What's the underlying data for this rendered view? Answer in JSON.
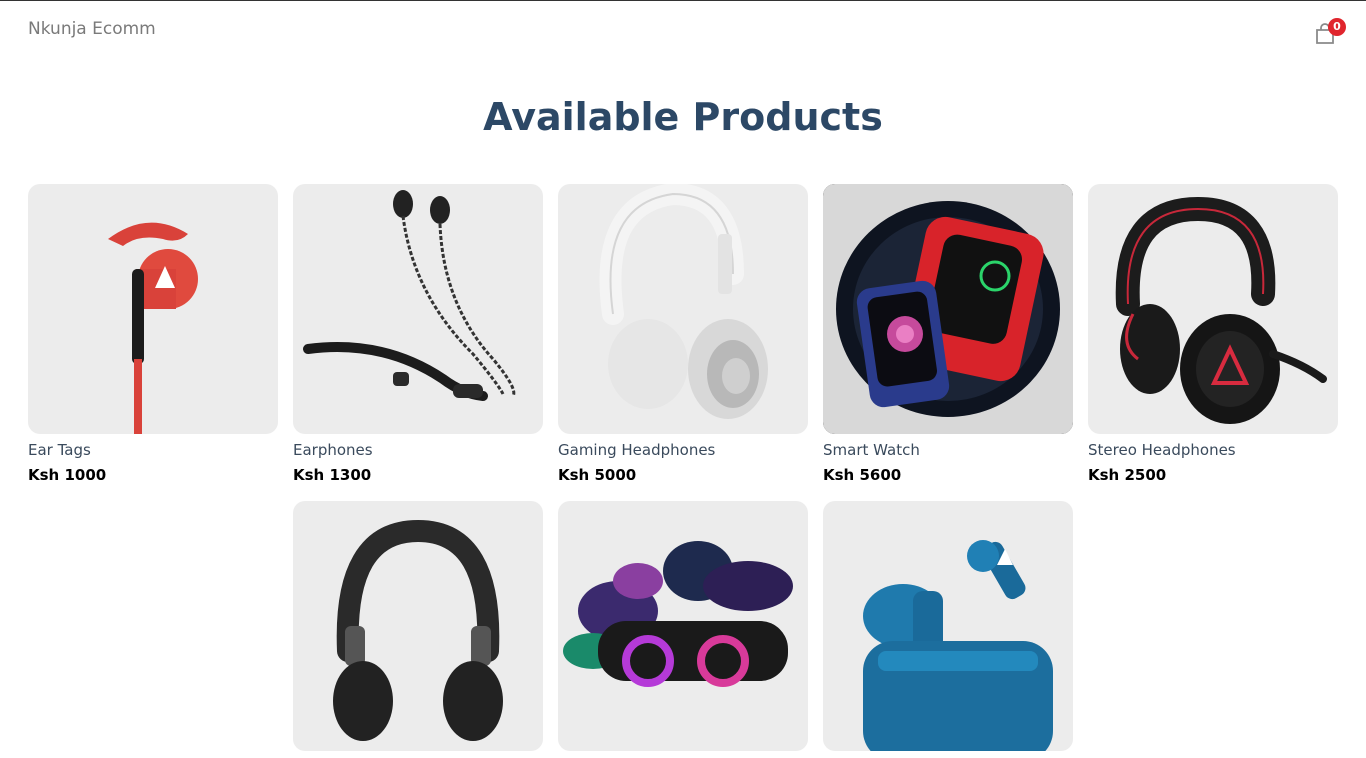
{
  "header": {
    "brand": "Nkunja Ecomm",
    "cart_count": "0"
  },
  "main": {
    "title": "Available Products",
    "products": [
      {
        "name": "Ear Tags",
        "price": "Ksh 1000"
      },
      {
        "name": "Earphones",
        "price": "Ksh 1300"
      },
      {
        "name": "Gaming Headphones",
        "price": "Ksh 5000"
      },
      {
        "name": "Smart Watch",
        "price": "Ksh 5600"
      },
      {
        "name": "Stereo Headphones",
        "price": "Ksh 2500"
      },
      {
        "name": "",
        "price": ""
      },
      {
        "name": "",
        "price": ""
      },
      {
        "name": "",
        "price": ""
      }
    ]
  },
  "colors": {
    "title": "#2c4866",
    "badge": "#e0252d",
    "card_bg": "#ececec"
  },
  "icons": {
    "cart": "shopping-bag-icon"
  }
}
